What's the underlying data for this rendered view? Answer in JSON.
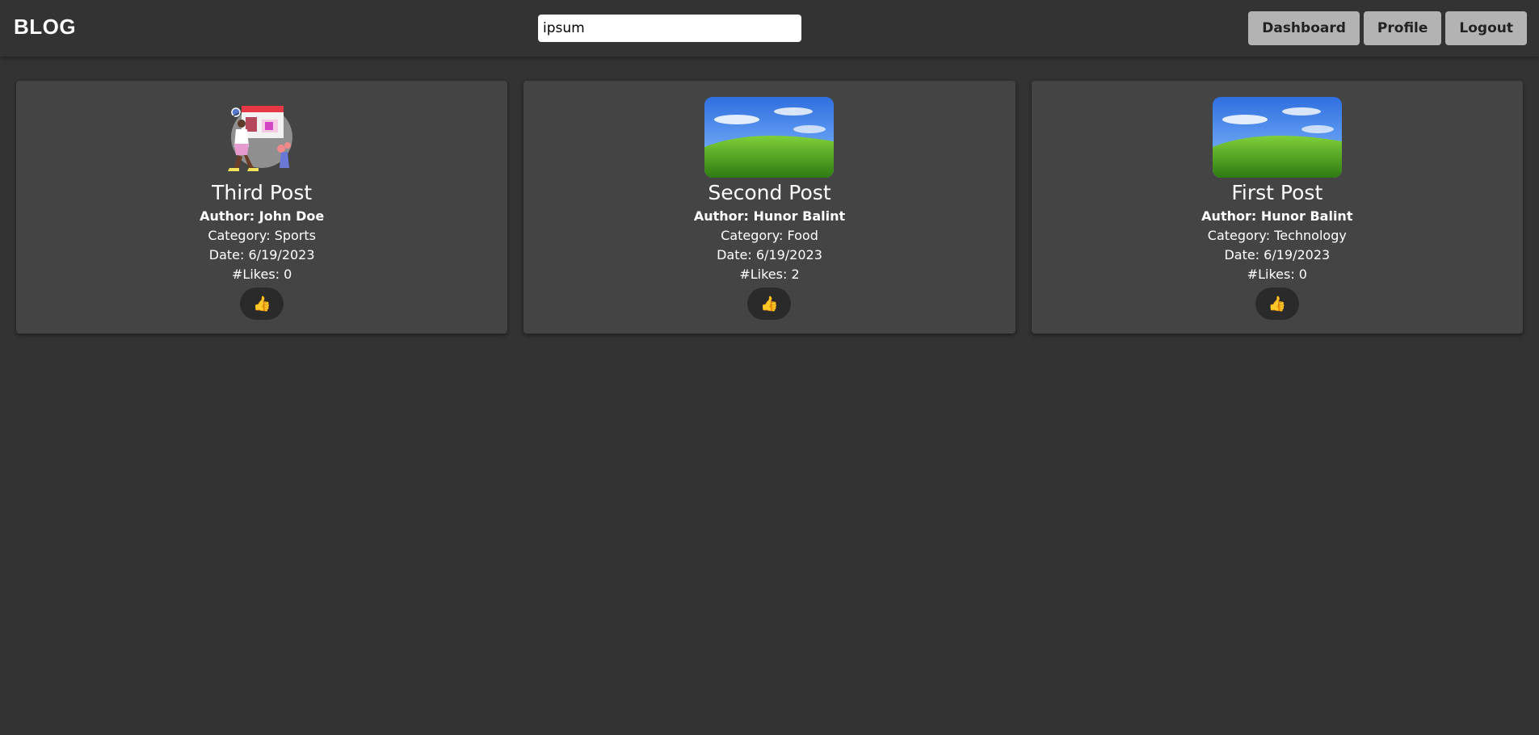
{
  "header": {
    "brand": "BLOG",
    "search": {
      "value": "ipsum",
      "placeholder": ""
    },
    "buttons": {
      "dashboard": "Dashboard",
      "profile": "Profile",
      "logout": "Logout"
    }
  },
  "posts": [
    {
      "title": "Third Post",
      "author": "Author: John Doe",
      "category": "Category: Sports",
      "date": "Date: 6/19/2023",
      "likes": "#Likes: 0",
      "image": "illustration-person-board",
      "like_icon": "👍"
    },
    {
      "title": "Second Post",
      "author": "Author: Hunor Balint",
      "category": "Category: Food",
      "date": "Date: 6/19/2023",
      "likes": "#Likes: 2",
      "image": "landscape-green-hill",
      "like_icon": "👍"
    },
    {
      "title": "First Post",
      "author": "Author: Hunor Balint",
      "category": "Category: Technology",
      "date": "Date: 6/19/2023",
      "likes": "#Likes: 0",
      "image": "landscape-green-hill",
      "like_icon": "👍"
    }
  ],
  "colors": {
    "background": "#333333",
    "card": "#444444",
    "nav_button": "#b3b3b3",
    "like_button": "#2a2a2a"
  }
}
